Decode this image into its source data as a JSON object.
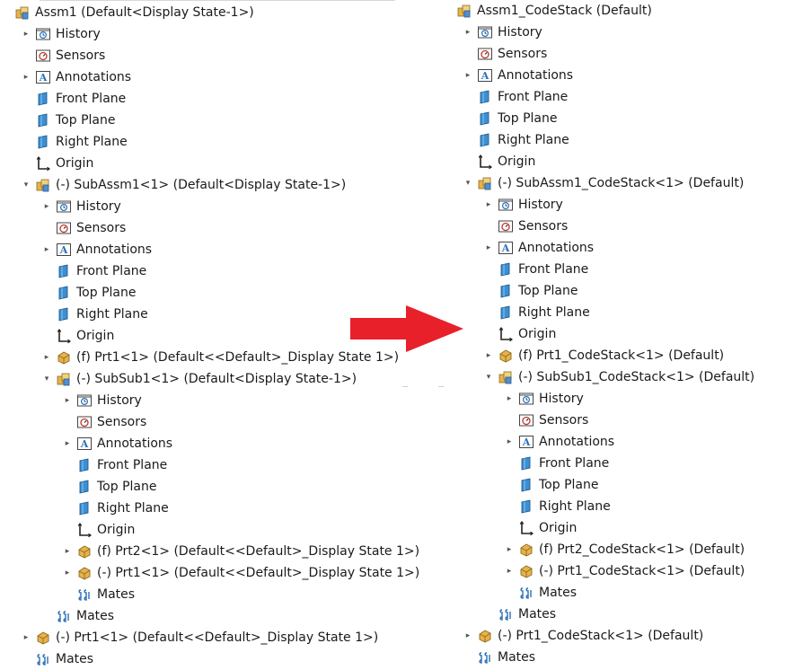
{
  "left_tree": [
    {
      "label": "Assm1  (Default<Display State-1>)",
      "icon": "assembly-icon",
      "level": 0,
      "expander": "none"
    },
    {
      "label": "History",
      "icon": "history-icon",
      "level": 1,
      "expander": "collapsed"
    },
    {
      "label": "Sensors",
      "icon": "sensors-icon",
      "level": 1,
      "expander": "none"
    },
    {
      "label": "Annotations",
      "icon": "annotations-icon",
      "level": 1,
      "expander": "collapsed"
    },
    {
      "label": "Front Plane",
      "icon": "plane-icon",
      "level": 1,
      "expander": "none"
    },
    {
      "label": "Top Plane",
      "icon": "plane-icon",
      "level": 1,
      "expander": "none"
    },
    {
      "label": "Right Plane",
      "icon": "plane-icon",
      "level": 1,
      "expander": "none"
    },
    {
      "label": "Origin",
      "icon": "origin-icon",
      "level": 1,
      "expander": "none"
    },
    {
      "label": "(-) SubAssm1<1> (Default<Display State-1>)",
      "icon": "subassembly-icon",
      "level": 1,
      "expander": "expanded"
    },
    {
      "label": "History",
      "icon": "history-icon",
      "level": 2,
      "expander": "collapsed"
    },
    {
      "label": "Sensors",
      "icon": "sensors-icon",
      "level": 2,
      "expander": "none"
    },
    {
      "label": "Annotations",
      "icon": "annotations-icon",
      "level": 2,
      "expander": "collapsed"
    },
    {
      "label": "Front Plane",
      "icon": "plane-icon",
      "level": 2,
      "expander": "none"
    },
    {
      "label": "Top Plane",
      "icon": "plane-icon",
      "level": 2,
      "expander": "none"
    },
    {
      "label": "Right Plane",
      "icon": "plane-icon",
      "level": 2,
      "expander": "none"
    },
    {
      "label": "Origin",
      "icon": "origin-icon",
      "level": 2,
      "expander": "none"
    },
    {
      "label": "(f) Prt1<1> (Default<<Default>_Display State 1>)",
      "icon": "part-icon",
      "level": 2,
      "expander": "collapsed"
    },
    {
      "label": "(-) SubSub1<1> (Default<Display State-1>)",
      "icon": "subassembly-icon",
      "level": 2,
      "expander": "expanded"
    },
    {
      "label": "History",
      "icon": "history-icon",
      "level": 3,
      "expander": "collapsed"
    },
    {
      "label": "Sensors",
      "icon": "sensors-icon",
      "level": 3,
      "expander": "none"
    },
    {
      "label": "Annotations",
      "icon": "annotations-icon",
      "level": 3,
      "expander": "collapsed"
    },
    {
      "label": "Front Plane",
      "icon": "plane-icon",
      "level": 3,
      "expander": "none"
    },
    {
      "label": "Top Plane",
      "icon": "plane-icon",
      "level": 3,
      "expander": "none"
    },
    {
      "label": "Right Plane",
      "icon": "plane-icon",
      "level": 3,
      "expander": "none"
    },
    {
      "label": "Origin",
      "icon": "origin-icon",
      "level": 3,
      "expander": "none"
    },
    {
      "label": "(f) Prt2<1> (Default<<Default>_Display State 1>)",
      "icon": "part-icon",
      "level": 3,
      "expander": "collapsed"
    },
    {
      "label": "(-) Prt1<1> (Default<<Default>_Display State 1>)",
      "icon": "part-icon",
      "level": 3,
      "expander": "collapsed"
    },
    {
      "label": "Mates",
      "icon": "mates-icon",
      "level": 3,
      "expander": "none"
    },
    {
      "label": "Mates",
      "icon": "mates-icon",
      "level": 2,
      "expander": "none"
    },
    {
      "label": "(-) Prt1<1> (Default<<Default>_Display State 1>)",
      "icon": "part-icon",
      "level": 1,
      "expander": "collapsed"
    },
    {
      "label": "Mates",
      "icon": "mates-icon",
      "level": 1,
      "expander": "none"
    }
  ],
  "right_tree": [
    {
      "label": "Assm1_CodeStack  (Default)",
      "icon": "assembly-icon",
      "level": 0,
      "expander": "none"
    },
    {
      "label": "History",
      "icon": "history-icon",
      "level": 1,
      "expander": "collapsed"
    },
    {
      "label": "Sensors",
      "icon": "sensors-icon",
      "level": 1,
      "expander": "none"
    },
    {
      "label": "Annotations",
      "icon": "annotations-icon",
      "level": 1,
      "expander": "collapsed"
    },
    {
      "label": "Front Plane",
      "icon": "plane-icon",
      "level": 1,
      "expander": "none"
    },
    {
      "label": "Top Plane",
      "icon": "plane-icon",
      "level": 1,
      "expander": "none"
    },
    {
      "label": "Right Plane",
      "icon": "plane-icon",
      "level": 1,
      "expander": "none"
    },
    {
      "label": "Origin",
      "icon": "origin-icon",
      "level": 1,
      "expander": "none"
    },
    {
      "label": "(-) SubAssm1_CodeStack<1> (Default)",
      "icon": "subassembly-icon",
      "level": 1,
      "expander": "expanded"
    },
    {
      "label": "History",
      "icon": "history-icon",
      "level": 2,
      "expander": "collapsed"
    },
    {
      "label": "Sensors",
      "icon": "sensors-icon",
      "level": 2,
      "expander": "none"
    },
    {
      "label": "Annotations",
      "icon": "annotations-icon",
      "level": 2,
      "expander": "collapsed"
    },
    {
      "label": "Front Plane",
      "icon": "plane-icon",
      "level": 2,
      "expander": "none"
    },
    {
      "label": "Top Plane",
      "icon": "plane-icon",
      "level": 2,
      "expander": "none"
    },
    {
      "label": "Right Plane",
      "icon": "plane-icon",
      "level": 2,
      "expander": "none"
    },
    {
      "label": "Origin",
      "icon": "origin-icon",
      "level": 2,
      "expander": "none"
    },
    {
      "label": "(f) Prt1_CodeStack<1> (Default)",
      "icon": "part-icon",
      "level": 2,
      "expander": "collapsed"
    },
    {
      "label": "(-) SubSub1_CodeStack<1> (Default)",
      "icon": "subassembly-icon",
      "level": 2,
      "expander": "expanded"
    },
    {
      "label": "History",
      "icon": "history-icon",
      "level": 3,
      "expander": "collapsed"
    },
    {
      "label": "Sensors",
      "icon": "sensors-icon",
      "level": 3,
      "expander": "none"
    },
    {
      "label": "Annotations",
      "icon": "annotations-icon",
      "level": 3,
      "expander": "collapsed"
    },
    {
      "label": "Front Plane",
      "icon": "plane-icon",
      "level": 3,
      "expander": "none"
    },
    {
      "label": "Top Plane",
      "icon": "plane-icon",
      "level": 3,
      "expander": "none"
    },
    {
      "label": "Right Plane",
      "icon": "plane-icon",
      "level": 3,
      "expander": "none"
    },
    {
      "label": "Origin",
      "icon": "origin-icon",
      "level": 3,
      "expander": "none"
    },
    {
      "label": "(f) Prt2_CodeStack<1> (Default)",
      "icon": "part-icon",
      "level": 3,
      "expander": "collapsed"
    },
    {
      "label": "(-) Prt1_CodeStack<1> (Default)",
      "icon": "part-icon",
      "level": 3,
      "expander": "collapsed"
    },
    {
      "label": "Mates",
      "icon": "mates-icon",
      "level": 3,
      "expander": "none"
    },
    {
      "label": "Mates",
      "icon": "mates-icon",
      "level": 2,
      "expander": "none"
    },
    {
      "label": "(-) Prt1_CodeStack<1> (Default)",
      "icon": "part-icon",
      "level": 1,
      "expander": "collapsed"
    },
    {
      "label": "Mates",
      "icon": "mates-icon",
      "level": 1,
      "expander": "none"
    }
  ],
  "colors": {
    "arrow": "#e8202a",
    "text": "#1a1a1a",
    "plane": "#3d8fd0",
    "part": "#e8b24a",
    "expander": "#555555"
  },
  "arrow_icon": "right-arrow-icon"
}
